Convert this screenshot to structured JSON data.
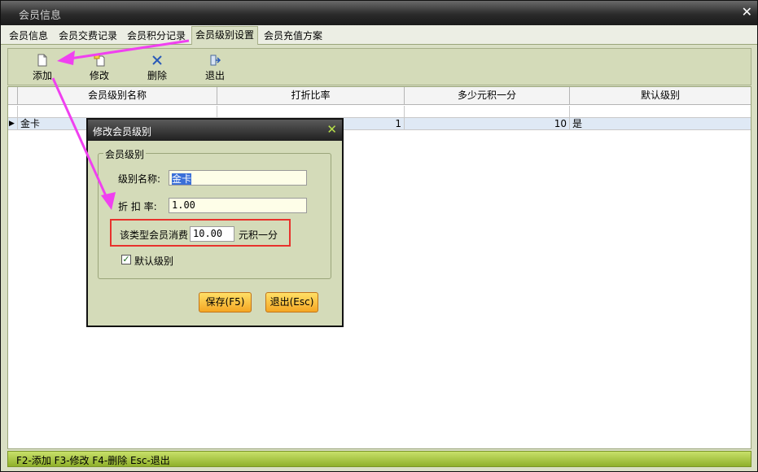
{
  "window": {
    "title": "会员信息"
  },
  "tabs": [
    {
      "label": "会员信息"
    },
    {
      "label": "会员交费记录"
    },
    {
      "label": "会员积分记录"
    },
    {
      "label": "会员级别设置"
    },
    {
      "label": "会员充值方案"
    }
  ],
  "toolbar": {
    "add": "添加",
    "edit": "修改",
    "delete": "删除",
    "exit": "退出"
  },
  "table": {
    "headers": [
      "会员级别名称",
      "打折比率",
      "多少元积一分",
      "默认级别"
    ],
    "rows": [
      {
        "name": "金卡",
        "discount": "1",
        "points_per": "10",
        "default": "是"
      }
    ]
  },
  "status": {
    "text": "F2-添加 F3-修改 F4-删除 Esc-退出"
  },
  "dialog": {
    "title": "修改会员级别",
    "group_label": "会员级别",
    "name_label": "级别名称:",
    "name_value": "金卡",
    "discount_label": "折 扣 率:",
    "discount_value": "1.00",
    "spend_prefix": "该类型会员消费",
    "spend_value": "10.00",
    "spend_suffix": "元积一分",
    "default_label": "默认级别",
    "default_checked": true,
    "save_label": "保存(F5)",
    "exit_label": "退出(Esc)"
  },
  "colors": {
    "annotation_arrow": "#f040f0",
    "highlight_box": "#e8322c",
    "status_bar": "#a8c83a"
  }
}
